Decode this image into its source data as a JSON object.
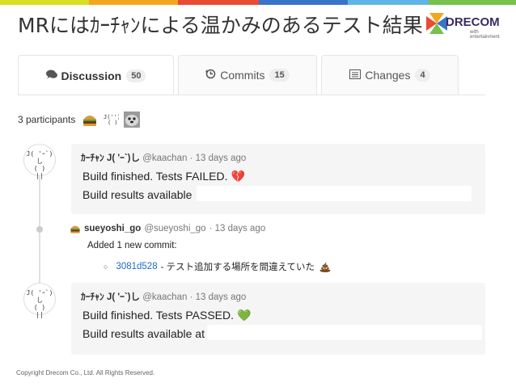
{
  "slide": {
    "title": "MRにはｶｰﾁｬﾝによる温かみのあるテスト結果",
    "copyright": "Copyright Drecom Co., Ltd. All Rights Reserved.",
    "logo": {
      "name": "DRECOM",
      "tagline": "with entertainment"
    },
    "accent_colors": [
      "#d8e021",
      "#f2a81d",
      "#e94b33",
      "#3a74c9",
      "#5fb6e6",
      "#76c24a"
    ]
  },
  "tabs": [
    {
      "label": "Discussion",
      "count": "50",
      "icon": "speech-bubbles-icon",
      "active": true
    },
    {
      "label": "Commits",
      "count": "15",
      "icon": "history-icon",
      "active": false
    },
    {
      "label": "Changes",
      "count": "4",
      "icon": "list-icon",
      "active": false
    }
  ],
  "participants": {
    "label": "3 participants"
  },
  "notes": [
    {
      "author": "ｶｰﾁｬﾝ J( 'ｰ`)し",
      "username": "@kaachan",
      "time": "· 13 days ago",
      "avatar_face": "J( 'ｰ`)し\n( )\n||",
      "status": "Build finished. Tests FAILED.",
      "status_emoji": "💔",
      "results": "Build results available"
    },
    {
      "author": "ｶｰﾁｬﾝ J( 'ｰ`)し",
      "username": "@kaachan",
      "time": "· 13 days ago",
      "avatar_face": "J( 'ｰ`)し\n( )\n||",
      "status": "Build finished. Tests PASSED.",
      "status_emoji": "💚",
      "results": "Build results available at"
    }
  ],
  "system_note": {
    "author": "sueyoshi_go",
    "username": "@sueyoshi_go",
    "time": "· 13 days ago",
    "action": "Added 1 new commit:",
    "commit_sha": "3081d528",
    "commit_message": "- テスト追加する場所を間違えていた"
  }
}
